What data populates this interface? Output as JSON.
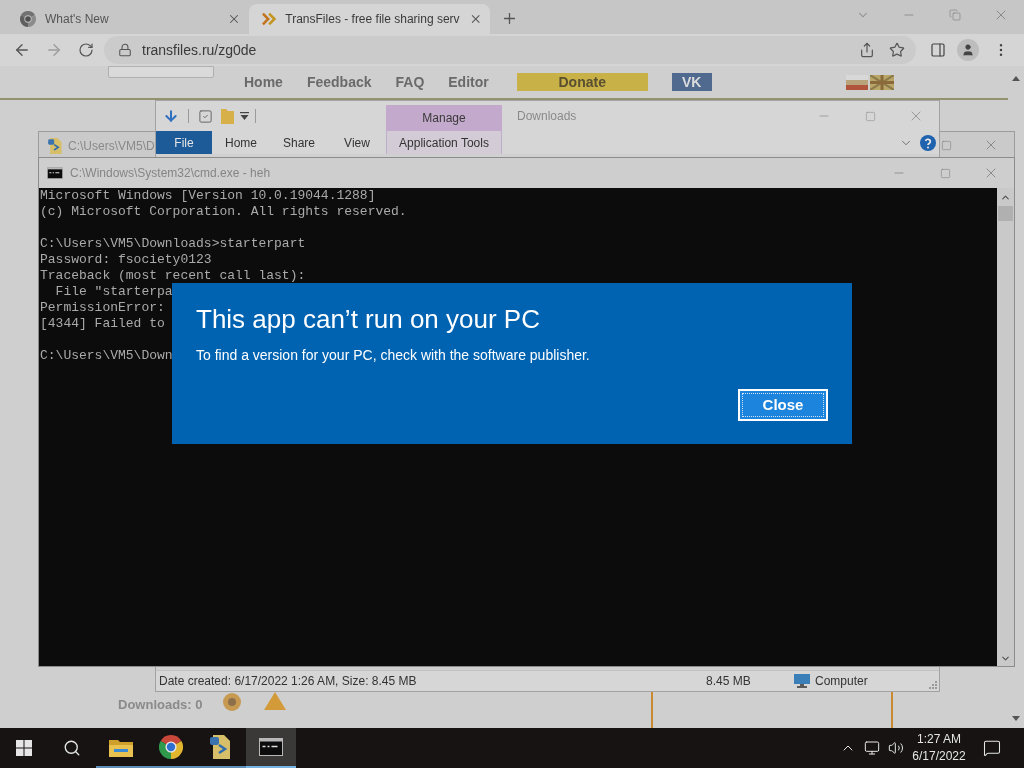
{
  "browser": {
    "tabs": [
      {
        "title": "What's New",
        "selected": false,
        "kind": "chrome"
      },
      {
        "title": "TransFiles - free file sharing serv",
        "selected": true,
        "kind": "transfiles"
      }
    ],
    "address": "transfiles.ru/zg0de",
    "site_nav": [
      {
        "label": "Home",
        "kind": "link"
      },
      {
        "label": "Feedback",
        "kind": "link"
      },
      {
        "label": "FAQ",
        "kind": "link"
      },
      {
        "label": "Editor",
        "kind": "link"
      },
      {
        "label": "Donate",
        "kind": "donate"
      },
      {
        "label": "VK",
        "kind": "vk"
      }
    ],
    "downloads_label": "Downloads: 0"
  },
  "background_window": {
    "title": "C:\\Users\\VM5\\D"
  },
  "explorer": {
    "title": "Downloads",
    "context_group": "Manage",
    "ribbon_tabs": [
      {
        "label": "File",
        "selected": false,
        "kind": "file"
      },
      {
        "label": "Home",
        "selected": false,
        "kind": "tab"
      },
      {
        "label": "Share",
        "selected": false,
        "kind": "tab"
      },
      {
        "label": "View",
        "selected": false,
        "kind": "tab"
      },
      {
        "label": "Application Tools",
        "selected": false,
        "kind": "context"
      }
    ],
    "status_bar": {
      "details": "Date created: 6/17/2022 1:26 AM, Size: 8.45 MB",
      "size": "8.45 MB",
      "location": "Computer"
    }
  },
  "console": {
    "title": "C:\\Windows\\System32\\cmd.exe - heh",
    "blocks": [
      [
        "Microsoft Windows [Version 10.0.19044.1288]",
        "(c) Microsoft Corporation. All rights reserved."
      ],
      [
        "C:\\Users\\VM5\\Downloads>starterpart",
        "Password: fsociety0123",
        "Traceback (most recent call last):",
        "  File \"starterpa",
        "PermissionError:",
        "[4344] Failed to"
      ],
      [
        "C:\\Users\\VM5\\Down"
      ]
    ]
  },
  "dialog": {
    "title": "This app can’t run on your PC",
    "message": "To find a version for your PC, check with the software publisher.",
    "button": "Close"
  },
  "taskbar": {
    "apps": [
      {
        "kind": "explorer",
        "selected": false
      },
      {
        "kind": "chrome",
        "selected": false
      },
      {
        "kind": "script",
        "selected": false
      },
      {
        "kind": "terminal",
        "selected": true
      }
    ],
    "time": "1:27 AM",
    "date": "6/17/2022"
  }
}
